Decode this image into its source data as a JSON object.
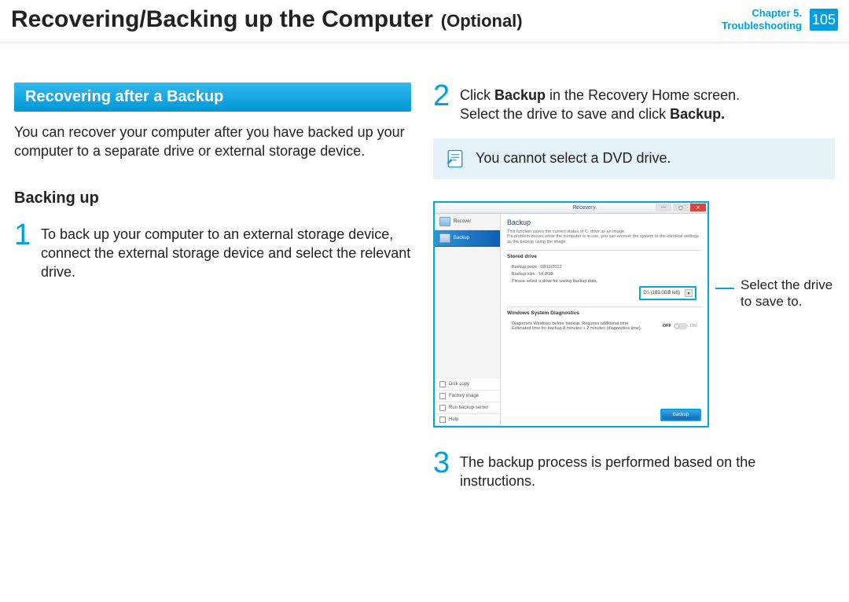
{
  "header": {
    "title_main": "Recovering/Backing up the Computer",
    "title_optional": "(Optional)",
    "chapter_line1": "Chapter 5.",
    "chapter_line2": "Troubleshooting",
    "page_number": "105"
  },
  "left": {
    "section_bar": "Recovering after a Backup",
    "intro": "You can recover your computer after you have backed up your computer to a separate drive or external storage device.",
    "sub_heading": "Backing up",
    "step1_num": "1",
    "step1_text": "To back up your computer to an external storage device, connect the external storage device and select the relevant drive."
  },
  "right": {
    "step2_num": "2",
    "step2_part1": "Click ",
    "step2_bold1": "Backup",
    "step2_part2": " in the Recovery Home screen.",
    "step2_line2a": "Select the drive to save and click ",
    "step2_line2b": "Backup.",
    "callout": "You cannot select a DVD drive.",
    "annot": "Select the drive to save to.",
    "step3_num": "3",
    "step3_text": "The backup process is performed based on the instructions."
  },
  "app": {
    "title": "Recovery",
    "sidebar_recover": "Recover",
    "sidebar_backup": "Backup",
    "sb_disk_copy": "Disk copy",
    "sb_factory": "Factory image",
    "sb_run": "Run backup server",
    "sb_help": "Help",
    "main_heading": "Backup",
    "main_desc": "This function saves the current status of C: drive as an image.\nIf a problem occurs while the computer is in use, you can recover the system to the identical settings as the backup using the image.",
    "panel_stored_drive": "Stored drive",
    "panel_bp": "Backup point : 09/11/2012",
    "panel_bs": "Backup size : 14.0GB",
    "panel_prompt": "Please select a drive for saving backup data.",
    "drive_sel": "D:\\ (189.0GB left)",
    "panel_diag_title": "Windows System Diagnostics",
    "panel_diag_desc": "Diagnoses Windows before backup. Requires additional time.\nEstimated time for backup 8 minutes + 2 minutes (diagnostics time).",
    "toggle_off": "OFF",
    "toggle_on": "ON",
    "backup_btn": "Backup"
  }
}
